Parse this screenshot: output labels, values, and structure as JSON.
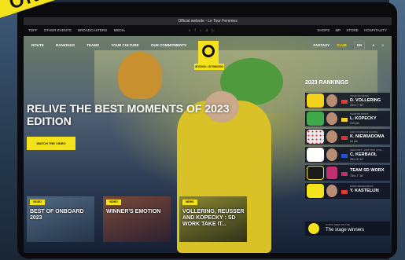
{
  "overlay": {
    "tape_text": "ONLINE"
  },
  "browser": {
    "title": "Official website - Le Tour Femmes"
  },
  "topbar": {
    "left_links": [
      "TDFF",
      "OTHER EVENTS",
      "BROADCASTERS",
      "MEDIA"
    ],
    "center_text": "x f ♪ d ▷",
    "right_links": [
      "SHOPS",
      "MP",
      "STORE",
      "HOSPITALITY"
    ]
  },
  "nav": {
    "items": [
      "ROUTE",
      "RANKINGS",
      "TEAMS",
      "YOUR CULTURE",
      "OUR COMMITMENTS"
    ],
    "fantasy": "FANTASY",
    "club": "CLUB",
    "lang": "EN",
    "search_icon": "search-icon",
    "menu_icon": "hamburger-icon"
  },
  "logo": {
    "badge": "8/7/2023 • 8/7/08/2023"
  },
  "hero": {
    "headline": "RELIVE THE BEST MOMENTS OF 2023 EDITION",
    "cta": "WATCH THE VIDEO"
  },
  "rankings": {
    "title": "2023 RANKINGS",
    "entries": [
      {
        "category": "YOUR SO WORK",
        "name": "D. VOLLERING",
        "value": "26h 17' 35\"",
        "jersey_color": "#f2d21c",
        "flag_color": "#e63a3a"
      },
      {
        "category": "TEAM SD WORX",
        "name": "L. KOPECKY",
        "value": "243 pts",
        "jersey_color": "#3faa4a",
        "flag_color": "#f5d02a"
      },
      {
        "category": "CANYON//SRAM RACING",
        "name": "K. NIEWIADOMA",
        "value": "64 pts",
        "jersey_color": "#e8e8e8",
        "flag_color": "#e03030"
      },
      {
        "category": "CERATIZIT - WNT PRO CYCL...",
        "name": "C. KERBAOL",
        "value": "26h 26' 40\"",
        "jersey_color": "#ffffff",
        "flag_color": "#2550c8"
      },
      {
        "category": "",
        "name": "TEAM SD WORX",
        "value": "78h 17' 38\"",
        "jersey_color": "#1a1a1a",
        "flag_color": "#c03070"
      },
      {
        "category": "FENIX-DECEUNINCK",
        "name": "Y. KASTELIJN",
        "value": "",
        "jersey_color": "#f4e21c",
        "flag_color": "#e03a3a"
      }
    ],
    "stage_category": "GOING DEEP ON THE",
    "stage_winners": "The stage winners"
  },
  "news": [
    {
      "badge": "VIDEO",
      "title": "BEST OF ONBOARD 2023"
    },
    {
      "badge": "VIDEO",
      "title": "WINNER'S EMOTION"
    },
    {
      "badge": "NEWS",
      "title": "VOLLERING, REUSSER AND KOPECKY : SD WORK TAKE IT..."
    }
  ],
  "colors": {
    "accent": "#f4e21c"
  }
}
